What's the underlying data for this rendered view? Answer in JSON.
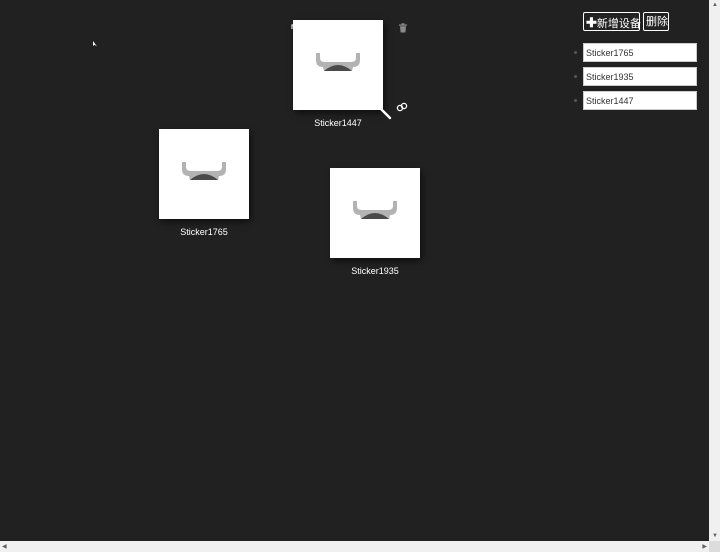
{
  "toolbar": {
    "add_icon": "plus-icon",
    "add_label": "新增设备",
    "delete_label": "删除"
  },
  "device_list": [
    {
      "value": "Sticker1765"
    },
    {
      "value": "Sticker1935"
    },
    {
      "value": "Sticker1447"
    }
  ],
  "stickers": [
    {
      "label": "Sticker1765",
      "icon": "bowl-icon"
    },
    {
      "label": "Sticker1935",
      "icon": "bowl-icon"
    },
    {
      "label": "Sticker1447",
      "icon": "bowl-icon",
      "selected": true
    }
  ],
  "selection_tools": {
    "delete_icon": "trash-icon",
    "link_icon": "link-icon",
    "resize_icon": "resize-handle-icon"
  },
  "colors": {
    "background": "#212121",
    "card": "#ffffff",
    "bowl_rim": "#b3b3b3",
    "bowl_fill": "#4a4a4a"
  }
}
